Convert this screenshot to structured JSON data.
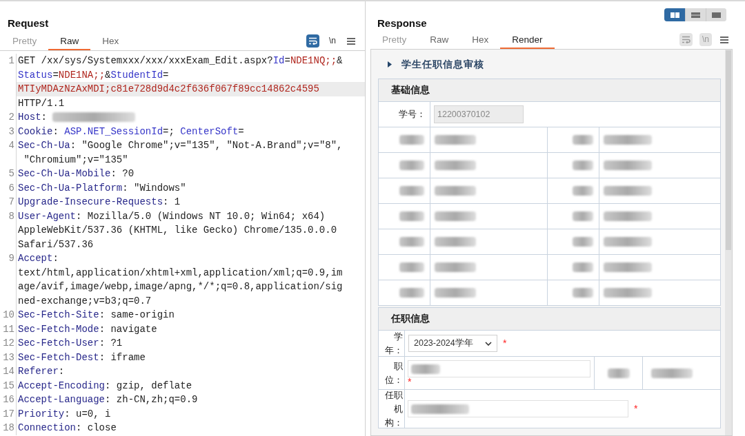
{
  "request": {
    "title": "Request",
    "tabs": [
      {
        "label": "Pretty",
        "selected": false
      },
      {
        "label": "Raw",
        "selected": true
      },
      {
        "label": "Hex",
        "selected": false
      }
    ],
    "toolbar": [
      {
        "kind": "wrap",
        "active": true,
        "disabled": false
      },
      {
        "kind": "newline",
        "label": "\\n",
        "active": false,
        "disabled": false
      },
      {
        "kind": "menu"
      }
    ],
    "lines": [
      {
        "number": "1",
        "rows": [
          {
            "highlighted": false,
            "segments": [
              {
                "kind": "text",
                "text": "GET /xx/sys/Systemxxx/xxx/xxxExam_Edit.aspx?"
              },
              {
                "kind": "param",
                "text": "Id"
              },
              {
                "kind": "text",
                "text": "="
              },
              {
                "kind": "value",
                "text": "NDE1NQ;;"
              },
              {
                "kind": "text",
                "text": "&"
              }
            ]
          },
          {
            "highlighted": false,
            "segments": [
              {
                "kind": "param",
                "text": "Status"
              },
              {
                "kind": "text",
                "text": "="
              },
              {
                "kind": "value",
                "text": "NDE1NA;;"
              },
              {
                "kind": "text",
                "text": "&"
              },
              {
                "kind": "param",
                "text": "StudentId"
              },
              {
                "kind": "text",
                "text": "="
              }
            ]
          },
          {
            "highlighted": true,
            "segments": [
              {
                "kind": "value",
                "text": "MTIyMDAzNzAxMDI;c81e728d9d4c2f636f067f89cc14862c4595"
              }
            ]
          },
          {
            "highlighted": false,
            "segments": [
              {
                "kind": "text",
                "text": "HTTP/1.1"
              }
            ]
          }
        ]
      },
      {
        "number": "2",
        "rows": [
          {
            "highlighted": false,
            "segments": [
              {
                "kind": "header",
                "text": "Host"
              },
              {
                "kind": "text",
                "text": ": "
              },
              {
                "kind": "redacted"
              }
            ]
          }
        ]
      },
      {
        "number": "3",
        "rows": [
          {
            "highlighted": false,
            "segments": [
              {
                "kind": "header",
                "text": "Cookie"
              },
              {
                "kind": "text",
                "text": ": "
              },
              {
                "kind": "param",
                "text": "ASP.NET_SessionId"
              },
              {
                "kind": "text",
                "text": "=; "
              },
              {
                "kind": "param",
                "text": "CenterSoft"
              },
              {
                "kind": "text",
                "text": "="
              }
            ]
          }
        ]
      },
      {
        "number": "4",
        "rows": [
          {
            "highlighted": false,
            "segments": [
              {
                "kind": "header",
                "text": "Sec-Ch-Ua"
              },
              {
                "kind": "text",
                "text": ": \"Google Chrome\";v=\"135\", \"Not-A.Brand\";v=\"8\","
              }
            ]
          },
          {
            "highlighted": false,
            "segments": [
              {
                "kind": "text",
                "text": " \"Chromium\";v=\"135\""
              }
            ]
          }
        ]
      },
      {
        "number": "5",
        "rows": [
          {
            "highlighted": false,
            "segments": [
              {
                "kind": "header",
                "text": "Sec-Ch-Ua-Mobile"
              },
              {
                "kind": "text",
                "text": ": ?0"
              }
            ]
          }
        ]
      },
      {
        "number": "6",
        "rows": [
          {
            "highlighted": false,
            "segments": [
              {
                "kind": "header",
                "text": "Sec-Ch-Ua-Platform"
              },
              {
                "kind": "text",
                "text": ": \"Windows\""
              }
            ]
          }
        ]
      },
      {
        "number": "7",
        "rows": [
          {
            "highlighted": false,
            "segments": [
              {
                "kind": "header",
                "text": "Upgrade-Insecure-Requests"
              },
              {
                "kind": "text",
                "text": ": 1"
              }
            ]
          }
        ]
      },
      {
        "number": "8",
        "rows": [
          {
            "highlighted": false,
            "segments": [
              {
                "kind": "header",
                "text": "User-Agent"
              },
              {
                "kind": "text",
                "text": ": Mozilla/5.0 (Windows NT 10.0; Win64; x64)"
              }
            ]
          },
          {
            "highlighted": false,
            "segments": [
              {
                "kind": "text",
                "text": "AppleWebKit/537.36 (KHTML, like Gecko) Chrome/135.0.0.0"
              }
            ]
          },
          {
            "highlighted": false,
            "segments": [
              {
                "kind": "text",
                "text": "Safari/537.36"
              }
            ]
          }
        ]
      },
      {
        "number": "9",
        "rows": [
          {
            "highlighted": false,
            "segments": [
              {
                "kind": "header",
                "text": "Accept"
              },
              {
                "kind": "text",
                "text": ":"
              }
            ]
          },
          {
            "highlighted": false,
            "segments": [
              {
                "kind": "text",
                "text": "text/html,application/xhtml+xml,application/xml;q=0.9,im"
              }
            ]
          },
          {
            "highlighted": false,
            "segments": [
              {
                "kind": "text",
                "text": "age/avif,image/webp,image/apng,*/*;q=0.8,application/sig"
              }
            ]
          },
          {
            "highlighted": false,
            "segments": [
              {
                "kind": "text",
                "text": "ned-exchange;v=b3;q=0.7"
              }
            ]
          }
        ]
      },
      {
        "number": "10",
        "rows": [
          {
            "highlighted": false,
            "segments": [
              {
                "kind": "header",
                "text": "Sec-Fetch-Site"
              },
              {
                "kind": "text",
                "text": ": same-origin"
              }
            ]
          }
        ]
      },
      {
        "number": "11",
        "rows": [
          {
            "highlighted": false,
            "segments": [
              {
                "kind": "header",
                "text": "Sec-Fetch-Mode"
              },
              {
                "kind": "text",
                "text": ": navigate"
              }
            ]
          }
        ]
      },
      {
        "number": "12",
        "rows": [
          {
            "highlighted": false,
            "segments": [
              {
                "kind": "header",
                "text": "Sec-Fetch-User"
              },
              {
                "kind": "text",
                "text": ": ?1"
              }
            ]
          }
        ]
      },
      {
        "number": "13",
        "rows": [
          {
            "highlighted": false,
            "segments": [
              {
                "kind": "header",
                "text": "Sec-Fetch-Dest"
              },
              {
                "kind": "text",
                "text": ": iframe"
              }
            ]
          }
        ]
      },
      {
        "number": "14",
        "rows": [
          {
            "highlighted": false,
            "segments": [
              {
                "kind": "header",
                "text": "Referer"
              },
              {
                "kind": "text",
                "text": ":"
              }
            ]
          }
        ]
      },
      {
        "number": "15",
        "rows": [
          {
            "highlighted": false,
            "segments": [
              {
                "kind": "header",
                "text": "Accept-Encoding"
              },
              {
                "kind": "text",
                "text": ": gzip, deflate"
              }
            ]
          }
        ]
      },
      {
        "number": "16",
        "rows": [
          {
            "highlighted": false,
            "segments": [
              {
                "kind": "header",
                "text": "Accept-Language"
              },
              {
                "kind": "text",
                "text": ": zh-CN,zh;q=0.9"
              }
            ]
          }
        ]
      },
      {
        "number": "17",
        "rows": [
          {
            "highlighted": false,
            "segments": [
              {
                "kind": "header",
                "text": "Priority"
              },
              {
                "kind": "text",
                "text": ": u=0, i"
              }
            ]
          }
        ]
      },
      {
        "number": "18",
        "rows": [
          {
            "highlighted": false,
            "segments": [
              {
                "kind": "header",
                "text": "Connection"
              },
              {
                "kind": "text",
                "text": ": close"
              }
            ]
          }
        ]
      }
    ]
  },
  "response": {
    "title": "Response",
    "layout_toggle": [
      {
        "kind": "columns",
        "selected": true
      },
      {
        "kind": "rows",
        "selected": false
      },
      {
        "kind": "single",
        "selected": false
      }
    ],
    "tabs": [
      {
        "label": "Pretty",
        "selected": false
      },
      {
        "label": "Raw",
        "selected": false
      },
      {
        "label": "Hex",
        "selected": false
      },
      {
        "label": "Render",
        "selected": true
      }
    ],
    "toolbar": [
      {
        "kind": "wrap",
        "disabled": true
      },
      {
        "kind": "newline",
        "label": "\\n",
        "disabled": true
      },
      {
        "kind": "menu"
      }
    ],
    "render": {
      "heading": "学生任职信息审核",
      "sections": [
        {
          "title": "基础信息",
          "rows": [
            {
              "kind": "field",
              "label": "学号：",
              "value": "12200370102"
            },
            {
              "kind": "redacted"
            },
            {
              "kind": "redacted"
            },
            {
              "kind": "redacted"
            },
            {
              "kind": "redacted"
            },
            {
              "kind": "redacted"
            },
            {
              "kind": "redacted"
            },
            {
              "kind": "redacted"
            }
          ]
        },
        {
          "title": "任职信息",
          "rows": [
            {
              "kind": "select",
              "label": "学年：",
              "value": "2023-2024学年",
              "required_mark": "*"
            },
            {
              "kind": "redacted-field",
              "label": "职位：",
              "required_mark": "*"
            },
            {
              "kind": "redacted-input",
              "label": "任职机构：",
              "required_mark": "*"
            }
          ]
        }
      ]
    }
  }
}
